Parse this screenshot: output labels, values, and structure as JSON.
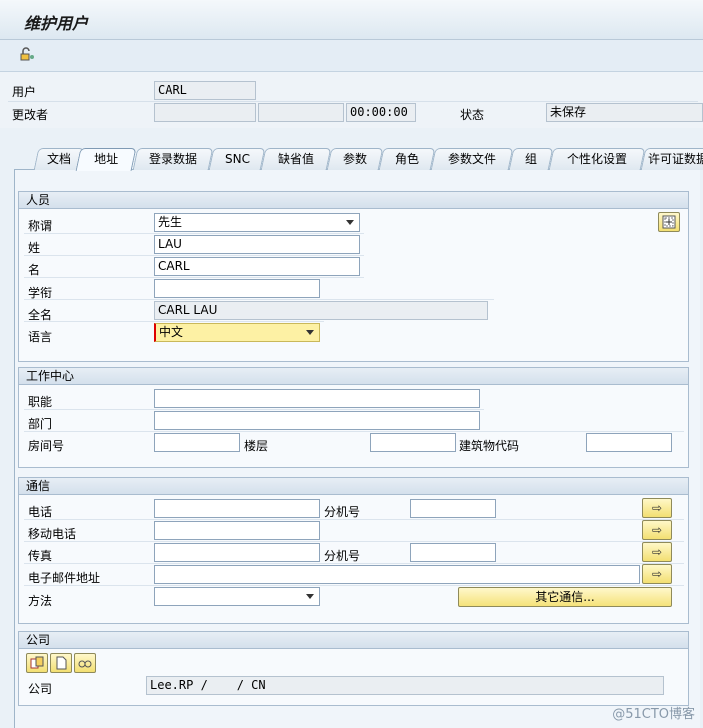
{
  "window": {
    "title": "维护用户"
  },
  "toolbar": {
    "lock_icon": "lock-toggle-icon"
  },
  "header": {
    "user_label": "用户",
    "user_value": "CARL",
    "changed_by_label": "更改者",
    "changed_by_value": "",
    "changed_date_value": "",
    "changed_time_value": "00:00:00",
    "status_label": "状态",
    "status_value": "未保存"
  },
  "tabs": [
    {
      "label": "文档"
    },
    {
      "label": "地址"
    },
    {
      "label": "登录数据"
    },
    {
      "label": "SNC"
    },
    {
      "label": "缺省值"
    },
    {
      "label": "参数"
    },
    {
      "label": "角色"
    },
    {
      "label": "参数文件"
    },
    {
      "label": "组"
    },
    {
      "label": "个性化设置"
    },
    {
      "label": "许可证数据"
    }
  ],
  "active_tab": "地址",
  "person": {
    "header": "人员",
    "title_label": "称谓",
    "title_value": "先生",
    "last_name_label": "姓",
    "last_name_value": "LAU",
    "first_name_label": "名",
    "first_name_value": "CARL",
    "academic_label": "学衔",
    "academic_value": "",
    "full_name_label": "全名",
    "full_name_value": "CARL LAU",
    "language_label": "语言",
    "language_value": "中文"
  },
  "work_center": {
    "header": "工作中心",
    "function_label": "职能",
    "function_value": "",
    "department_label": "部门",
    "department_value": "",
    "room_label": "房间号",
    "room_value": "",
    "floor_label": "楼层",
    "floor_value": "",
    "building_label": "建筑物代码",
    "building_value": ""
  },
  "communication": {
    "header": "通信",
    "phone_label": "电话",
    "phone_value": "",
    "ext_label": "分机号",
    "ext_value": "",
    "mobile_label": "移动电话",
    "mobile_value": "",
    "fax_label": "传真",
    "fax_value": "",
    "fax_ext_label": "分机号",
    "fax_ext_value": "",
    "email_label": "电子邮件地址",
    "email_value": "",
    "method_label": "方法",
    "method_value": "",
    "other_comm_button": "其它通信..."
  },
  "company": {
    "header": "公司",
    "company_label": "公司",
    "company_value": "Lee.RP /    / CN"
  },
  "watermark": "@51CTO博客"
}
